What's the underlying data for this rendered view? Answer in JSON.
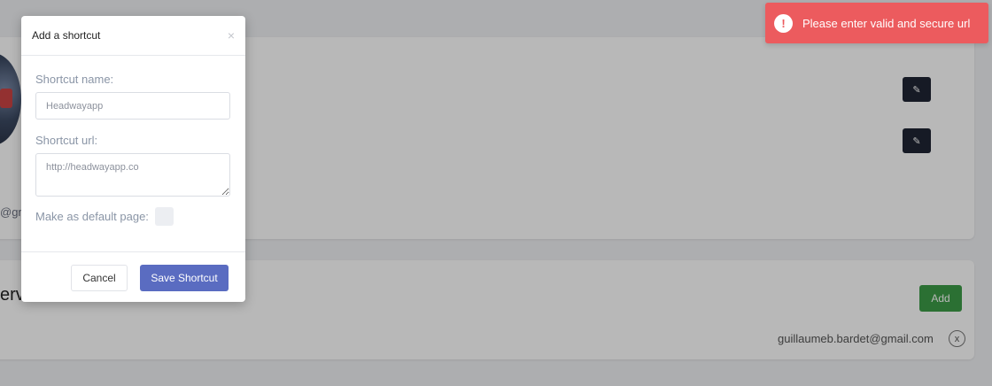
{
  "background": {
    "email_fragment": "@gr",
    "section_title_fragment": "erv",
    "add_label": "Add",
    "shared_email": "guillaumeb.bardet@gmail.com",
    "remove_label": "x"
  },
  "modal": {
    "title": "Add a shortcut",
    "close_glyph": "×",
    "name_label": "Shortcut name:",
    "name_placeholder": "Headwayapp",
    "name_value": "",
    "url_label": "Shortcut url:",
    "url_placeholder": "http://headwayapp.co",
    "url_value": "",
    "default_label": "Make as default page:",
    "default_checked": false,
    "cancel_label": "Cancel",
    "save_label": "Save Shortcut"
  },
  "toast": {
    "icon_glyph": "!",
    "message": "Please enter valid and secure url",
    "color": "#ec5b5e"
  },
  "colors": {
    "primary": "#5a6cc1",
    "success": "#3c9b47",
    "dark": "#1f2534"
  }
}
